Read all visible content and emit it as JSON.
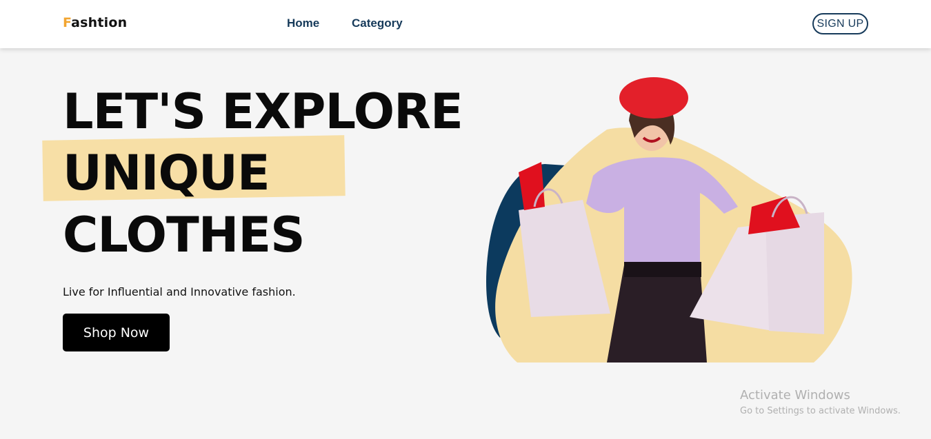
{
  "brand": {
    "first_letter": "F",
    "rest": "ashtion"
  },
  "nav": {
    "home": "Home",
    "category": "Category",
    "signup": "SIGN UP"
  },
  "hero": {
    "line1": "LET'S EXPLORE",
    "line2": "UNIQUE",
    "line3": "CLOTHES",
    "tagline": "Live for Influential and Innovative fashion.",
    "cta": "Shop Now"
  },
  "watermark": {
    "title": "Activate Windows",
    "subtitle": "Go to Settings to activate Windows."
  },
  "colors": {
    "accent": "#f2a531",
    "highlight": "#f7dfa6",
    "navy": "#163a5a",
    "blob_dark": "#0c3a5e"
  }
}
